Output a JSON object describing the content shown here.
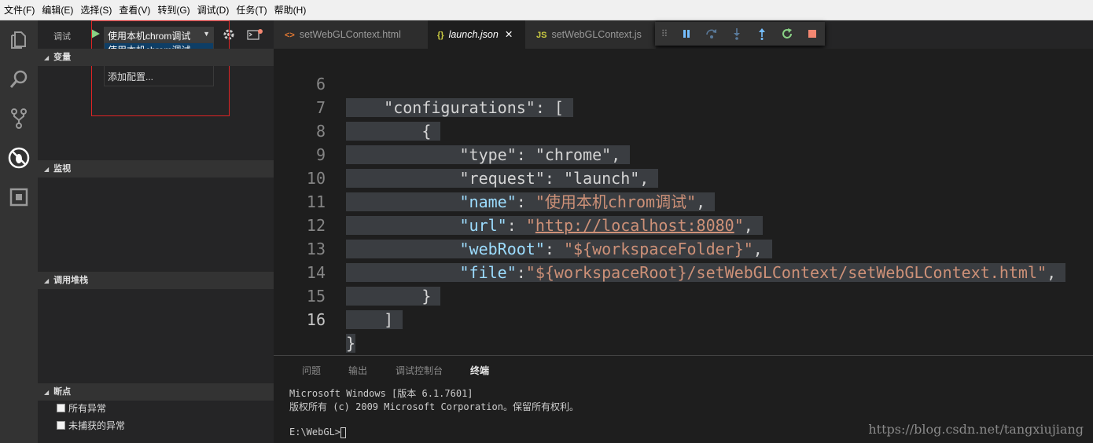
{
  "menu": [
    "文件(F)",
    "编辑(E)",
    "选择(S)",
    "查看(V)",
    "转到(G)",
    "调试(D)",
    "任务(T)",
    "帮助(H)"
  ],
  "activity_icons": [
    "explorer-icon",
    "search-icon",
    "source-control-icon",
    "debug-icon",
    "extensions-icon"
  ],
  "sidebar": {
    "title": "调试",
    "config_selected": "使用本机chrom调试",
    "dropdown": {
      "option1": "使用本机chrom调试",
      "option2": "添加配置..."
    },
    "sections": {
      "variables": "变量",
      "watch": "监视",
      "callstack": "调用堆栈",
      "breakpoints": "断点"
    },
    "breakpoints": {
      "all": "所有异常",
      "uncaught": "未捕获的异常"
    }
  },
  "tabs": [
    {
      "icon": "<>",
      "label": "setWebGLContext.html"
    },
    {
      "icon": "{}",
      "label": "launch.json",
      "close": "✕"
    },
    {
      "icon": "JS",
      "label": "setWebGLContext.js"
    }
  ],
  "code": {
    "line_numbers": [
      "6",
      "7",
      "8",
      "9",
      "10",
      "11",
      "12",
      "13",
      "14",
      "15",
      "16"
    ],
    "l6_key": "\"configurations\"",
    "l6_rest": ": [",
    "l7": "{",
    "l8_key": "\"type\"",
    "l8_val": "\"chrome\"",
    "l9_key": "\"request\"",
    "l9_val": "\"launch\"",
    "l10_key": "\"name\"",
    "l10_val": "\"使用本机chrom调试\"",
    "l11_key": "\"url\"",
    "l11_q1": "\"",
    "l11_url": "http://localhost:8080",
    "l11_q2": "\"",
    "l12_key": "\"webRoot\"",
    "l12_val": "\"${workspaceFolder}\"",
    "l13_key": "\"file\"",
    "l13_val": "\"${workspaceRoot}/setWebGLContext/setWebGLContext.html\"",
    "l14": "}",
    "l15": "]",
    "l16": "}"
  },
  "panel": {
    "tabs": [
      "问题",
      "输出",
      "调试控制台",
      "终端"
    ],
    "terminal_lines": [
      "Microsoft Windows [版本 6.1.7601]",
      "版权所有 (c) 2009 Microsoft Corporation。保留所有权利。",
      "E:\\WebGL>"
    ],
    "watermark": "https://blog.csdn.net/tangxiujiang"
  },
  "colors": {
    "accent_green": "#89d185",
    "stop_red": "#f48771",
    "blue": "#75beff",
    "selection": "#3a3d41"
  }
}
